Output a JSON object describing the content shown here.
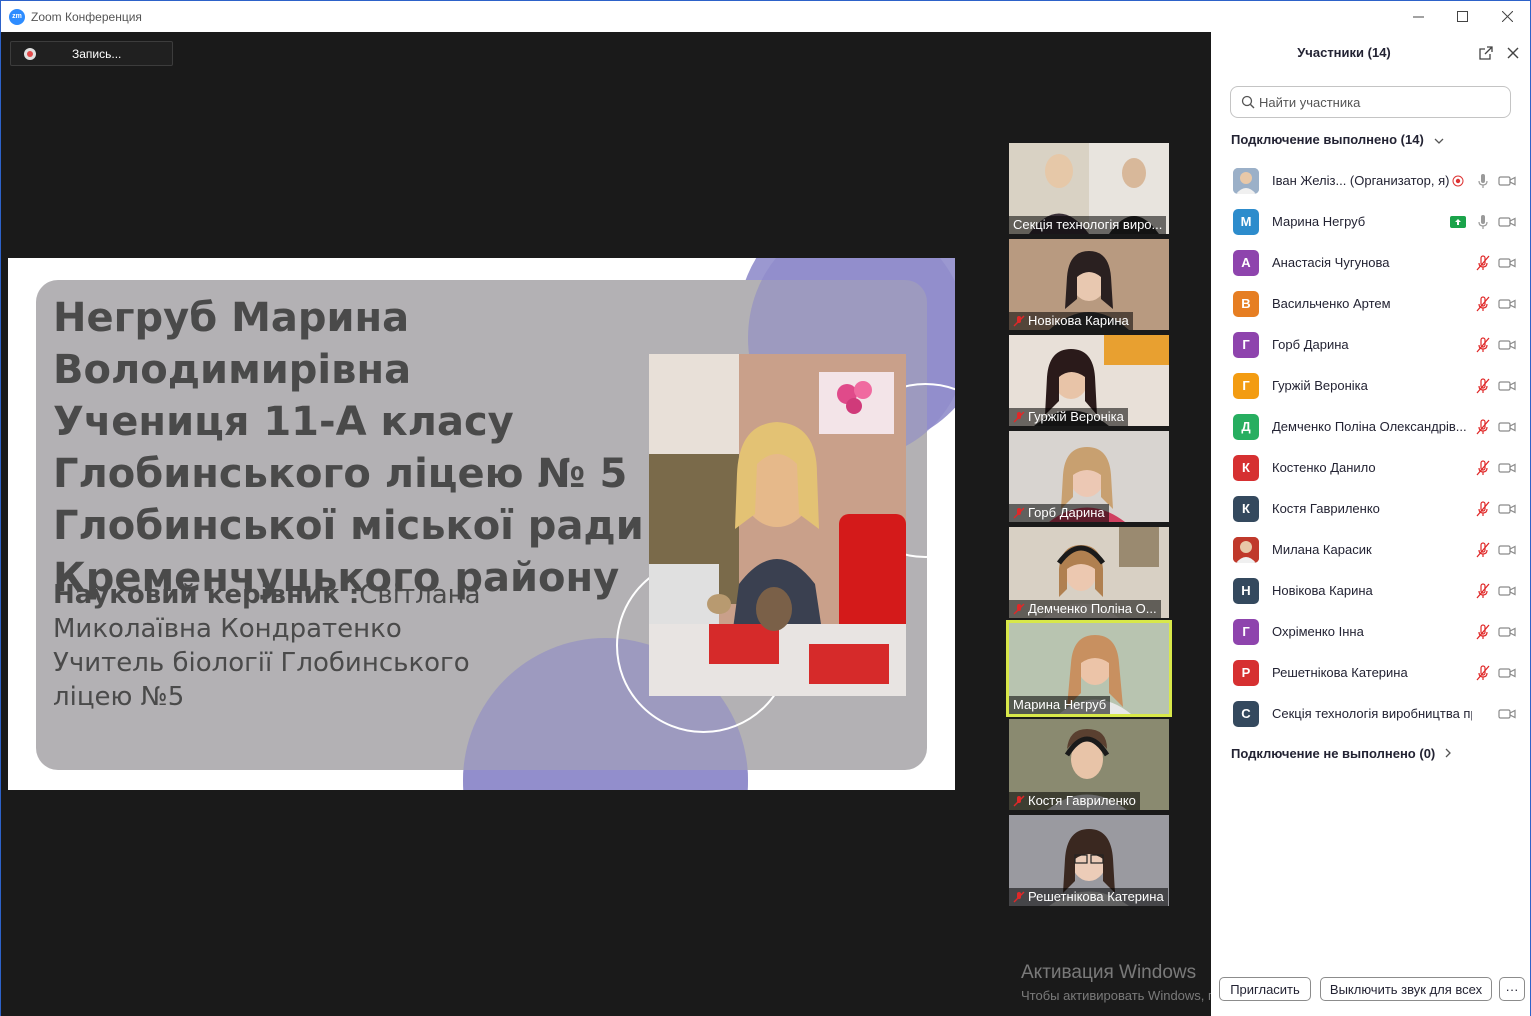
{
  "window": {
    "logo": "zm",
    "title": "Zoom Конференция",
    "controls": [
      "minimize-icon",
      "maximize-icon",
      "close-icon"
    ]
  },
  "recording": {
    "label": "Запись..."
  },
  "slide": {
    "heading": [
      "Негруб Марина Володимирівна",
      "Учениця 11-А класу",
      "Глобинського ліцею № 5",
      "Глобинської міської ради",
      "Кременчуцького району"
    ],
    "supervisor_label": "Науковий керівник :",
    "supervisor_rest": "Світлана Миколаївна Кондратенко",
    "teacher_line": "Учитель біології  Глобинського ліцею №5",
    "colors": {
      "card": "#b3b1b4",
      "circle": "#8a86c8",
      "text": "#4a4a4a"
    }
  },
  "thumbnails": [
    {
      "name": "Секція технологія виро...",
      "muted": false,
      "active": false
    },
    {
      "name": "Новікова Карина",
      "muted": true,
      "active": false
    },
    {
      "name": "Гуржій Вероніка",
      "muted": true,
      "active": false
    },
    {
      "name": "Горб Дарина",
      "muted": true,
      "active": false
    },
    {
      "name": "Демченко Поліна  О...",
      "muted": true,
      "active": false
    },
    {
      "name": "Марина Негруб",
      "muted": false,
      "active": true
    },
    {
      "name": "Костя  Гавриленко",
      "muted": true,
      "active": false
    },
    {
      "name": "Решетнікова Катерина",
      "muted": true,
      "active": false
    }
  ],
  "panel": {
    "title": "Участники (14)",
    "popout_icon": "popout-icon",
    "close_icon": "close-icon",
    "search_placeholder": "Найти участника",
    "connected_header": "Подключение выполнено (14)",
    "not_connected_header": "Подключение не выполнено (0)",
    "participants": [
      {
        "initial": "",
        "color": "#9bb0c8",
        "photo": true,
        "name": "Іван Желіз... (Организатор, я)",
        "recording": true,
        "share": false,
        "mic": "on"
      },
      {
        "initial": "М",
        "color": "#2d8ccc",
        "photo": false,
        "name": "Марина Негруб",
        "recording": false,
        "share": true,
        "mic": "on"
      },
      {
        "initial": "А",
        "color": "#8e44ad",
        "photo": false,
        "name": "Анастасія Чугунова",
        "recording": false,
        "share": false,
        "mic": "muted"
      },
      {
        "initial": "В",
        "color": "#e67e22",
        "photo": false,
        "name": "Васильченко Артем",
        "recording": false,
        "share": false,
        "mic": "muted"
      },
      {
        "initial": "Г",
        "color": "#8e44ad",
        "photo": false,
        "name": "Горб Дарина",
        "recording": false,
        "share": false,
        "mic": "muted"
      },
      {
        "initial": "Г",
        "color": "#f39c12",
        "photo": false,
        "name": "Гуржій Вероніка",
        "recording": false,
        "share": false,
        "mic": "muted"
      },
      {
        "initial": "Д",
        "color": "#27ae60",
        "photo": false,
        "name": "Демченко Поліна  Олександрів...",
        "recording": false,
        "share": false,
        "mic": "muted"
      },
      {
        "initial": "К",
        "color": "#d63031",
        "photo": false,
        "name": "Костенко Данило",
        "recording": false,
        "share": false,
        "mic": "muted"
      },
      {
        "initial": "К",
        "color": "#34495e",
        "photo": false,
        "name": "Костя  Гавриленко",
        "recording": false,
        "share": false,
        "mic": "muted"
      },
      {
        "initial": "",
        "color": "#c0392b",
        "photo": true,
        "name": "Милана Карасик",
        "recording": false,
        "share": false,
        "mic": "muted"
      },
      {
        "initial": "Н",
        "color": "#34495e",
        "photo": false,
        "name": "Новікова Карина",
        "recording": false,
        "share": false,
        "mic": "muted"
      },
      {
        "initial": "Г",
        "color": "#8e44ad",
        "photo": false,
        "name": "Охріменко Інна",
        "recording": false,
        "share": false,
        "mic": "muted"
      },
      {
        "initial": "Р",
        "color": "#d63031",
        "photo": false,
        "name": "Решетнікова Катерина",
        "recording": false,
        "share": false,
        "mic": "muted"
      },
      {
        "initial": "С",
        "color": "#34495e",
        "photo": false,
        "name": "Секція технологія виробництва про...",
        "recording": false,
        "share": false,
        "mic": "none"
      }
    ],
    "invite_label": "Пригласить",
    "mute_all_label": "Выключить звук для всех",
    "more_label": "···"
  },
  "watermark": {
    "line1": "Активация Windows",
    "line2": "Чтобы активировать Windows, перейдите в раздел \"Параметры\"."
  }
}
